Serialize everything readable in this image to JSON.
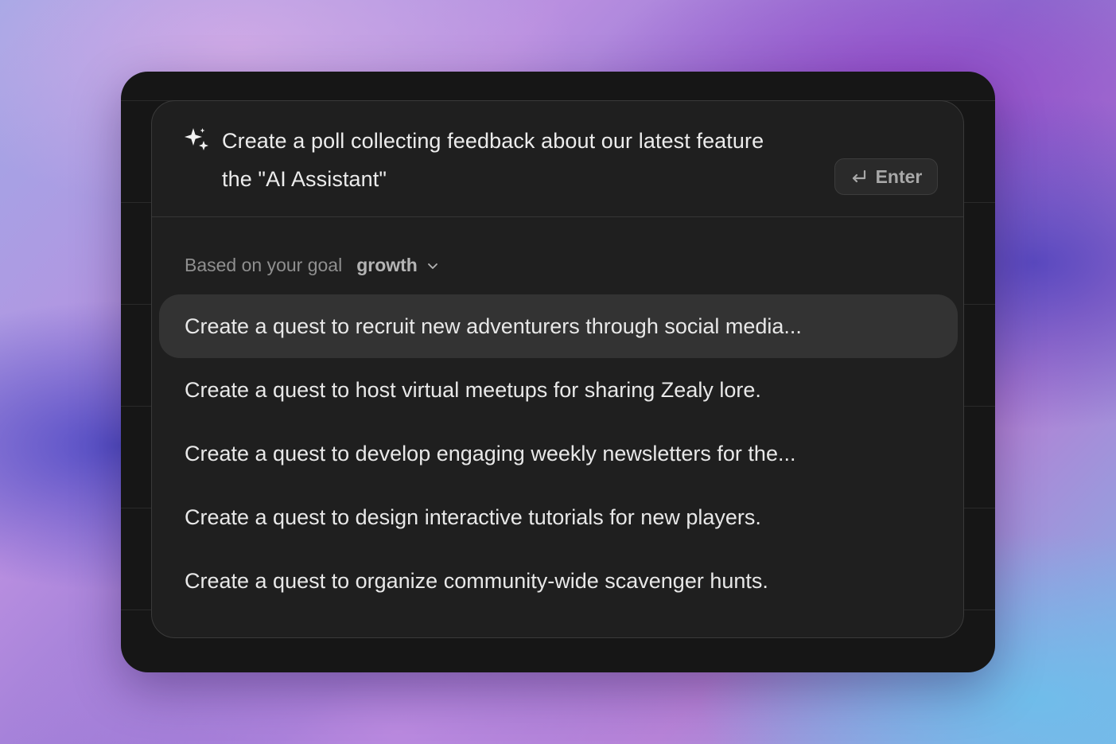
{
  "prompt": {
    "text_line1": "Create a poll collecting feedback about our latest feature",
    "text_line2": "the \"AI Assistant\"",
    "icon": "sparkle-icon"
  },
  "enter_button": {
    "label": "Enter",
    "icon": "return-icon"
  },
  "goal": {
    "label": "Based on your goal",
    "value": "growth",
    "icon": "chevron-down-icon"
  },
  "suggestions": [
    {
      "label": "Create a quest to recruit new adventurers through social media...",
      "active": true
    },
    {
      "label": "Create a quest to host virtual meetups for sharing Zealy lore.",
      "active": false
    },
    {
      "label": "Create a quest to develop engaging weekly newsletters for the...",
      "active": false
    },
    {
      "label": "Create a quest to design interactive tutorials for new players.",
      "active": false
    },
    {
      "label": "Create a quest to organize community-wide scavenger hunts.",
      "active": false
    }
  ],
  "colors": {
    "panel_background": "#1f1f1f",
    "active_row_background": "#333333",
    "text_primary": "#ececec",
    "text_muted": "#8f8f8f"
  }
}
